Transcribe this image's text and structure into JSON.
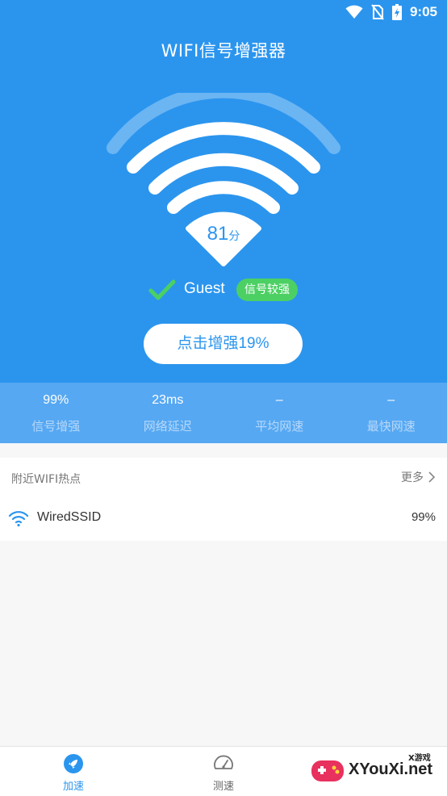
{
  "status_bar": {
    "time": "9:05",
    "icons": [
      "wifi-icon",
      "no-sim-icon",
      "battery-charging-icon"
    ]
  },
  "app": {
    "title": "WIFI信号增强器"
  },
  "hero": {
    "score_value": "81",
    "score_unit": "分",
    "network_name": "Guest",
    "signal_badge": "信号较强",
    "boost_button_label": "点击增强19%"
  },
  "stats": [
    {
      "value": "99%",
      "label": "信号增强"
    },
    {
      "value": "23ms",
      "label": "网络延迟"
    },
    {
      "value": "–",
      "label": "平均网速"
    },
    {
      "value": "–",
      "label": "最快网速"
    }
  ],
  "hotspots": {
    "title": "附近WIFI热点",
    "more_label": "更多",
    "items": [
      {
        "name": "WiredSSID",
        "signal": "99%"
      }
    ]
  },
  "bottom_nav": {
    "items": [
      {
        "label": "加速",
        "icon": "rocket-icon",
        "active": true
      },
      {
        "label": "测速",
        "icon": "speedometer-icon",
        "active": false
      }
    ]
  },
  "watermark": {
    "text": "XYouXi.net",
    "sub": "X游戏"
  },
  "colors": {
    "primary": "#2b95ee",
    "stats_bg": "#56a8f2",
    "badge": "#4cd064",
    "check": "#4cd064"
  }
}
